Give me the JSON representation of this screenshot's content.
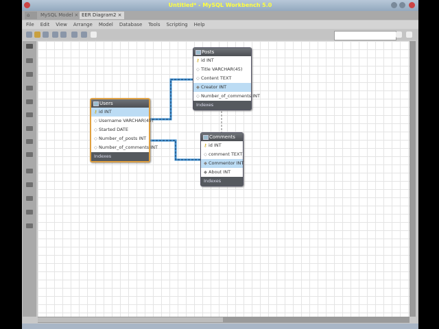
{
  "window": {
    "title": "Untitled* - MySQL Workbench 5.0"
  },
  "tabs": [
    {
      "label": "MySQL Model"
    },
    {
      "label": "EER Diagram2"
    }
  ],
  "menu": [
    "File",
    "Edit",
    "View",
    "Arrange",
    "Model",
    "Database",
    "Tools",
    "Scripting",
    "Help"
  ],
  "search": {
    "placeholder": ""
  },
  "tables": {
    "posts": {
      "name": "Posts",
      "columns": [
        "id INT",
        "Title VARCHAR(45)",
        "Content TEXT",
        "Creator INT",
        "Number_of_comments INT"
      ],
      "footer": "Indexes",
      "selected": 3
    },
    "users": {
      "name": "Users",
      "columns": [
        "id INT",
        "Username VARCHAR(45)",
        "Started DATE",
        "Number_of_posts INT",
        "Number_of_comments INT"
      ],
      "footer": "Indexes",
      "selected": 0
    },
    "comments": {
      "name": "Comments",
      "columns": [
        "id INT",
        "comment TEXT",
        "Commentor INT",
        "About INT"
      ],
      "footer": "Indexes",
      "selected": 2
    }
  },
  "colors": {
    "relationship": "#3d8fd0",
    "selected_table_border": "#e0a040"
  }
}
